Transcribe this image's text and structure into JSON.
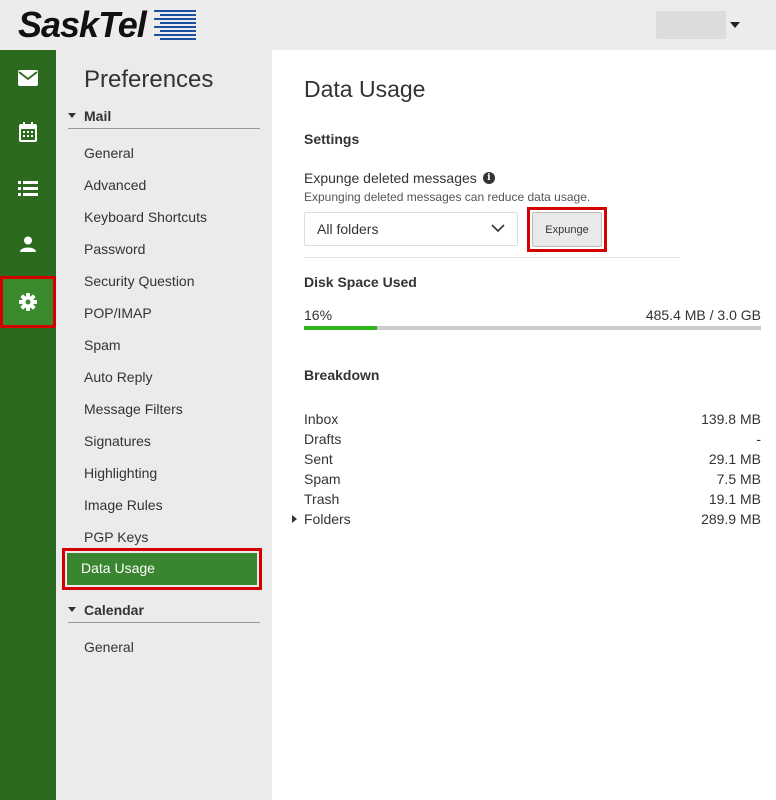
{
  "brand": {
    "name": "SaskTel"
  },
  "rail": {
    "items": [
      {
        "name": "mail",
        "icon": "envelope-icon"
      },
      {
        "name": "calendar",
        "icon": "calendar-icon"
      },
      {
        "name": "tasks",
        "icon": "list-icon"
      },
      {
        "name": "contacts",
        "icon": "person-icon"
      },
      {
        "name": "settings",
        "icon": "gear-icon",
        "active": true
      }
    ]
  },
  "preferences": {
    "title": "Preferences",
    "mail_section": "Mail",
    "mail_items": [
      "General",
      "Advanced",
      "Keyboard Shortcuts",
      "Password",
      "Security Question",
      "POP/IMAP",
      "Spam",
      "Auto Reply",
      "Message Filters",
      "Signatures",
      "Highlighting",
      "Image Rules",
      "PGP Keys",
      "Data Usage"
    ],
    "active_item": "Data Usage",
    "calendar_section": "Calendar",
    "calendar_items": [
      "General"
    ]
  },
  "main": {
    "title": "Data Usage",
    "settings_heading": "Settings",
    "expunge_label": "Expunge deleted messages",
    "expunge_hint": "Expunging deleted messages can reduce data usage.",
    "folder_select_value": "All folders",
    "expunge_button": "Expunge",
    "disk_heading": "Disk Space Used",
    "disk_percent_text": "16%",
    "disk_percent_value": 0.16,
    "disk_amount": "485.4 MB / 3.0 GB",
    "breakdown_heading": "Breakdown",
    "breakdown": [
      {
        "label": "Inbox",
        "value": "139.8 MB"
      },
      {
        "label": "Drafts",
        "value": "-"
      },
      {
        "label": "Sent",
        "value": "29.1 MB"
      },
      {
        "label": "Spam",
        "value": "7.5 MB"
      },
      {
        "label": "Trash",
        "value": "19.1 MB"
      },
      {
        "label": "Folders",
        "value": "289.9 MB",
        "expandable": true
      }
    ]
  },
  "colors": {
    "rail_bg": "#2b6a1f",
    "active_nav": "#3a8530",
    "progress": "#31b31b",
    "highlight": "#d40000"
  }
}
